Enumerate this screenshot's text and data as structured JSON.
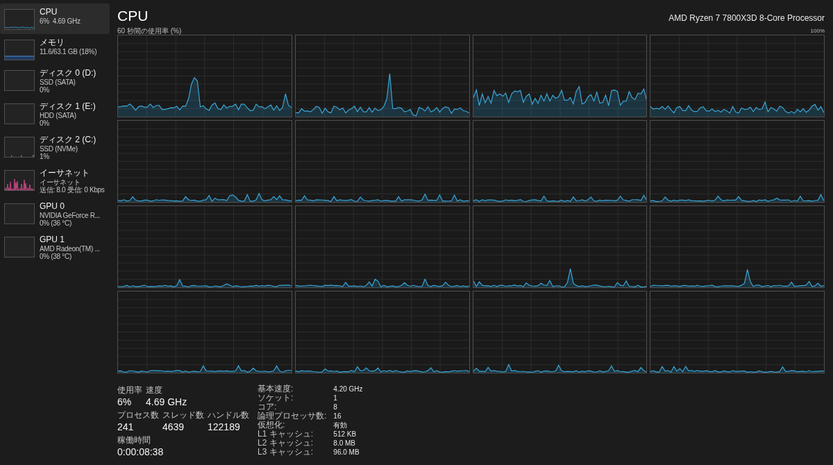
{
  "sidebar": {
    "items": [
      {
        "kind": "cpu",
        "title": "CPU",
        "details": [
          "6%  4.69 GHz"
        ],
        "selected": true
      },
      {
        "kind": "memory",
        "title": "メモリ",
        "details": [
          "11.6/63.1 GB (18%)"
        ],
        "selected": false
      },
      {
        "kind": "empty",
        "title": "ディスク 0 (D:)",
        "details": [
          "SSD (SATA)",
          "0%"
        ],
        "selected": false
      },
      {
        "kind": "empty",
        "title": "ディスク 1 (E:)",
        "details": [
          "HDD (SATA)",
          "0%"
        ],
        "selected": false
      },
      {
        "kind": "disk",
        "title": "ディスク 2 (C:)",
        "details": [
          "SSD (NVMe)",
          "1%"
        ],
        "selected": false
      },
      {
        "kind": "network",
        "title": "イーサネット",
        "details": [
          "イーサネット",
          "送信: 8.0 受信: 0 Kbps"
        ],
        "selected": false
      },
      {
        "kind": "empty",
        "title": "GPU 0",
        "details": [
          "NVIDIA GeForce R...",
          "0% (36 °C)"
        ],
        "selected": false
      },
      {
        "kind": "empty",
        "title": "GPU 1",
        "details": [
          "AMD Radeon(TM) ...",
          "0% (38 °C)"
        ],
        "selected": false
      }
    ]
  },
  "header": {
    "title": "CPU",
    "processor": "AMD Ryzen 7 7800X3D 8-Core Processor"
  },
  "graph": {
    "caption": "60 秒間の使用率 (%)",
    "max_label": "100%"
  },
  "stats": {
    "rows": [
      [
        {
          "label": "使用率",
          "value": "6%"
        },
        {
          "label": "速度",
          "value": "4.69 GHz"
        }
      ],
      [
        {
          "label": "プロセス数",
          "value": "241"
        },
        {
          "label": "スレッド数",
          "value": "4639"
        },
        {
          "label": "ハンドル数",
          "value": "122189"
        }
      ],
      [
        {
          "label": "稼働時間",
          "value": "0:00:08:38"
        }
      ]
    ]
  },
  "specs": [
    {
      "label": "基本速度:",
      "value": "4.20 GHz"
    },
    {
      "label": "ソケット:",
      "value": "1"
    },
    {
      "label": "コア:",
      "value": "8"
    },
    {
      "label": "論理プロセッサ数:",
      "value": "16"
    },
    {
      "label": "仮想化:",
      "value": "有効"
    },
    {
      "label": "L1 キャッシュ:",
      "value": "512 KB"
    },
    {
      "label": "L2 キャッシュ:",
      "value": "8.0 MB"
    },
    {
      "label": "L3 キャッシュ:",
      "value": "96.0 MB"
    }
  ]
}
